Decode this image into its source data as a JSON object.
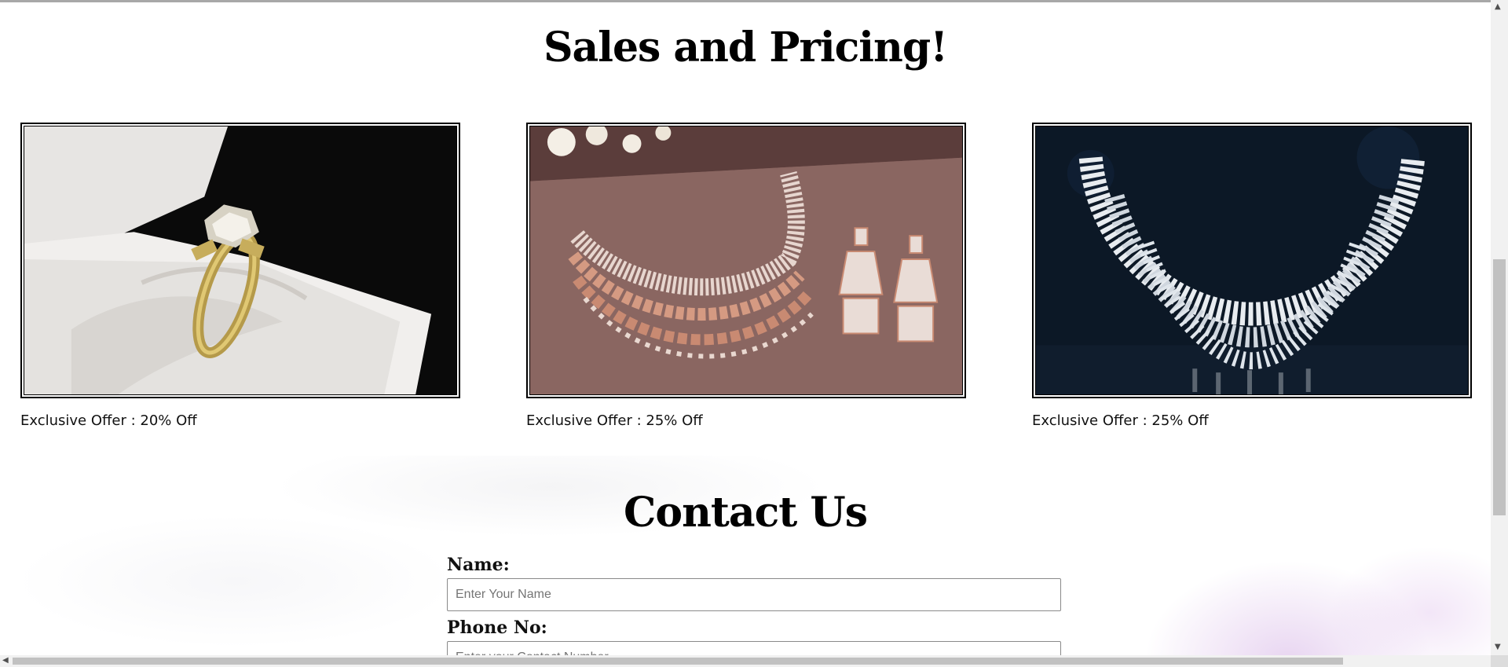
{
  "sales": {
    "title": "Sales and Pricing!",
    "cards": [
      {
        "offer": "Exclusive Offer : 20% Off",
        "image": "gold-diamond-ring-in-box"
      },
      {
        "offer": "Exclusive Offer : 25% Off",
        "image": "rose-gold-diamond-necklace-set"
      },
      {
        "offer": "Exclusive Offer : 25% Off",
        "image": "diamond-necklace-dark-background"
      }
    ]
  },
  "contact": {
    "title": "Contact Us",
    "name_label": "Name:",
    "name_placeholder": "Enter Your Name",
    "phone_label": "Phone No:",
    "phone_placeholder": "Enter your Contact Number"
  },
  "colors": {
    "page_background": "#ffffff",
    "text": "#000000",
    "scrollbar_track": "#f1f1f1",
    "scrollbar_thumb": "#c1c1c1"
  }
}
